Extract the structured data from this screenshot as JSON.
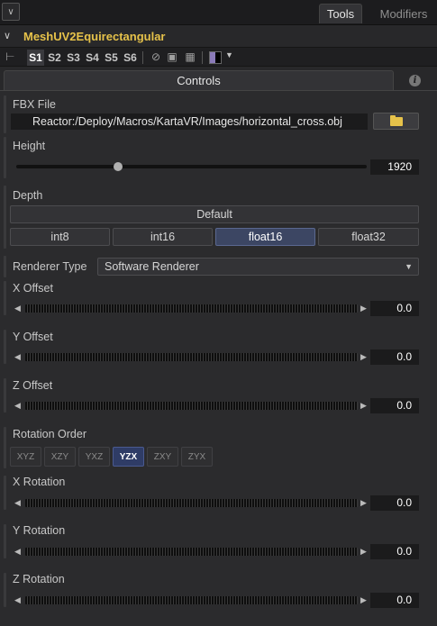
{
  "tabs": {
    "tools": "Tools",
    "modifiers": "Modifiers"
  },
  "tool": {
    "name": "MeshUV2Equirectangular"
  },
  "toolbar": {
    "scenes": [
      "S1",
      "S2",
      "S3",
      "S4",
      "S5",
      "S6"
    ],
    "active_scene": "S1"
  },
  "controls_tab": "Controls",
  "fbx": {
    "label": "FBX File",
    "value": "Reactor:/Deploy/Macros/KartaVR/Images/horizontal_cross.obj"
  },
  "height": {
    "label": "Height",
    "value": "1920",
    "slider_level": 0.29
  },
  "depth": {
    "label": "Depth",
    "default_label": "Default",
    "options": [
      "int8",
      "int16",
      "float16",
      "float32"
    ],
    "selected": "float16"
  },
  "renderer": {
    "label": "Renderer Type",
    "value": "Software Renderer"
  },
  "offsets": [
    {
      "label": "X Offset",
      "value": "0.0"
    },
    {
      "label": "Y Offset",
      "value": "0.0"
    },
    {
      "label": "Z Offset",
      "value": "0.0"
    }
  ],
  "rotation_order": {
    "label": "Rotation Order",
    "options": [
      "XYZ",
      "XZY",
      "YXZ",
      "YZX",
      "ZXY",
      "ZYX"
    ],
    "selected": "YZX"
  },
  "rotations": [
    {
      "label": "X Rotation",
      "value": "0.0"
    },
    {
      "label": "Y Rotation",
      "value": "0.0"
    },
    {
      "label": "Z Rotation",
      "value": "0.0"
    }
  ],
  "colors": {
    "title": "#e6c24a",
    "selected_button": "#3c4663",
    "panel_bg": "#2b2b2d",
    "header_bg": "#1c1c1e"
  }
}
